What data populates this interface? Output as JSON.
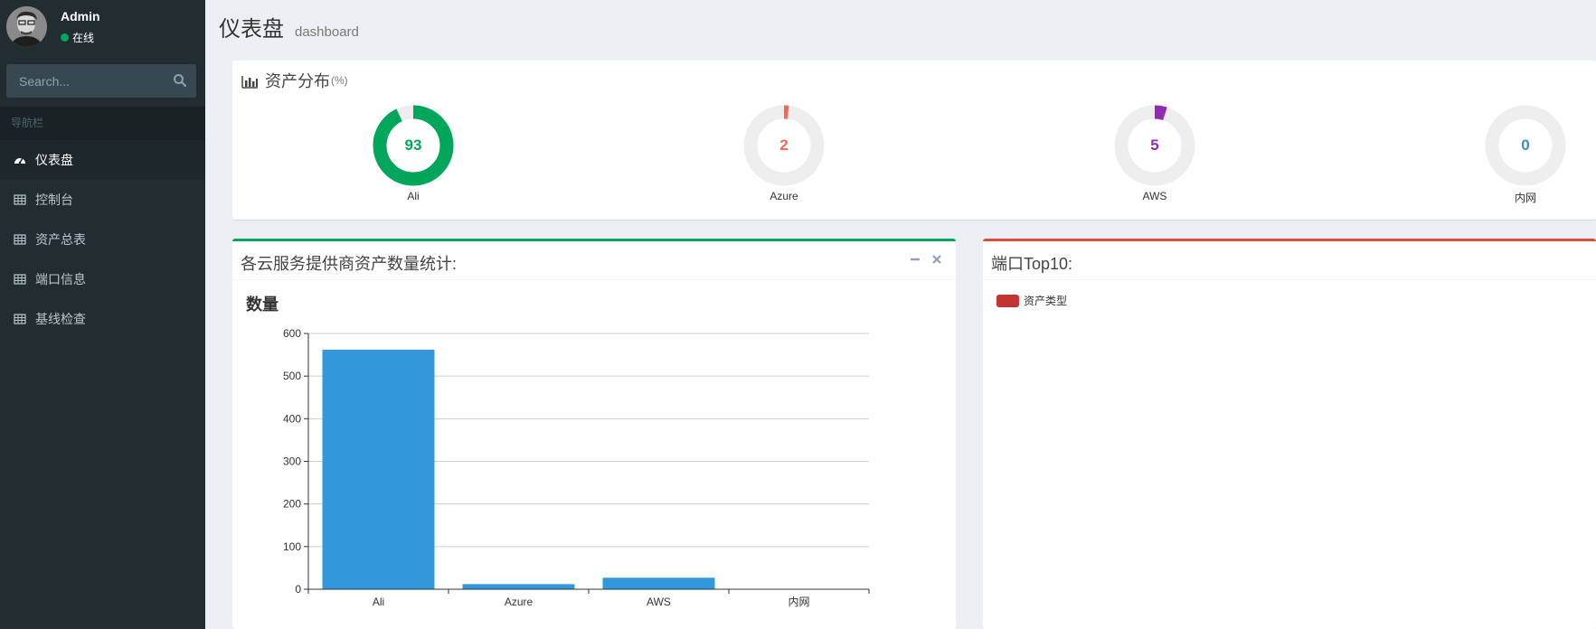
{
  "user": {
    "name": "Admin",
    "status": "在线"
  },
  "search": {
    "placeholder": "Search..."
  },
  "nav": {
    "header": "导航栏",
    "items": [
      {
        "label": "仪表盘",
        "icon": "dashboard-icon",
        "active": true
      },
      {
        "label": "控制台",
        "icon": "table-icon",
        "active": false
      },
      {
        "label": "资产总表",
        "icon": "table-icon",
        "active": false
      },
      {
        "label": "端口信息",
        "icon": "table-icon",
        "active": false
      },
      {
        "label": "基线检查",
        "icon": "table-icon",
        "active": false
      }
    ]
  },
  "page": {
    "title": "仪表盘",
    "subtitle": "dashboard"
  },
  "assets": {
    "title": "资产分布",
    "unit": "(%)",
    "donuts": [
      {
        "label": "Ali",
        "value": "93",
        "percent": 93,
        "color": "#00a65a"
      },
      {
        "label": "Azure",
        "value": "2",
        "percent": 2,
        "color": "#f56954"
      },
      {
        "label": "AWS",
        "value": "5",
        "percent": 5,
        "color": "#932ab6"
      },
      {
        "label": "内网",
        "value": "0",
        "percent": 0,
        "color": "#3c8dbc"
      }
    ]
  },
  "provider_box": {
    "title": "各云服务提供商资产数量统计:"
  },
  "ports_box": {
    "title": "端口Top10:",
    "legend": "资产类型",
    "legend_color": "#c23531"
  },
  "chart_data": {
    "type": "bar",
    "title": "数量",
    "categories": [
      "Ali",
      "Azure",
      "AWS",
      "内网"
    ],
    "values": [
      562,
      12,
      27,
      0
    ],
    "ylim": [
      0,
      600
    ],
    "yticks": [
      0,
      100,
      200,
      300,
      400,
      500,
      600
    ],
    "color": "#3398db",
    "grid": true
  }
}
